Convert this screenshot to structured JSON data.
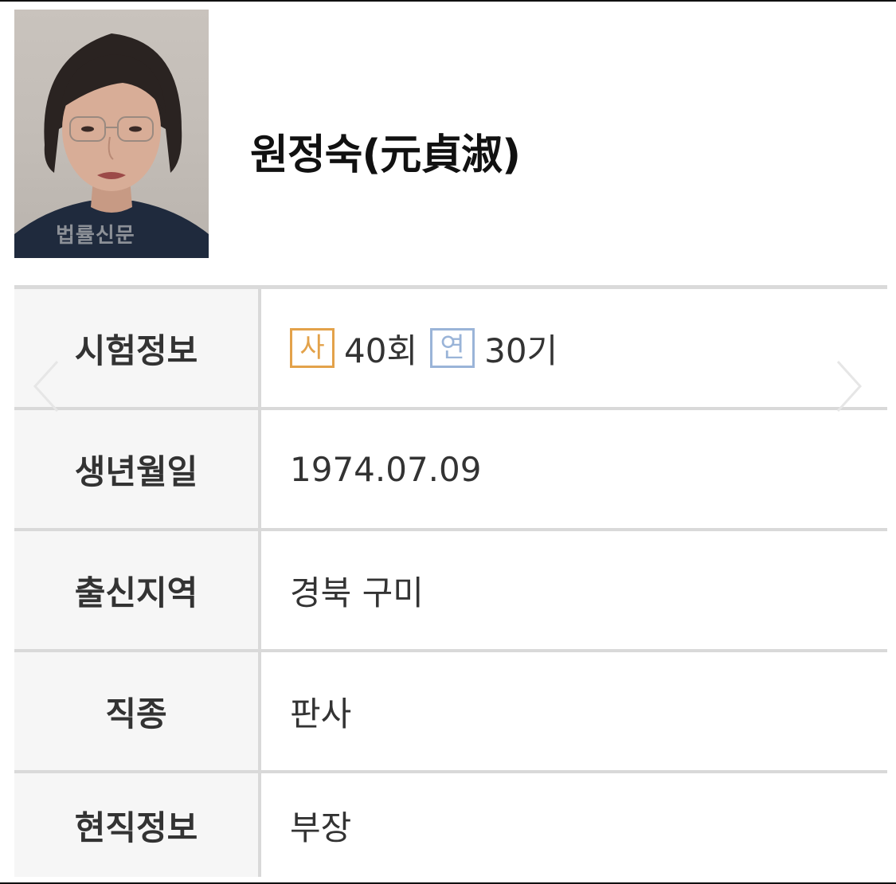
{
  "profile": {
    "name": "원정숙(元貞淑)",
    "photo_watermark": "법률신문"
  },
  "rows": [
    {
      "label": "시험정보",
      "exam_badge": "사",
      "exam_value": "40회",
      "train_badge": "연",
      "train_value": "30기"
    },
    {
      "label": "생년월일",
      "value": "1974.07.09"
    },
    {
      "label": "출신지역",
      "value": "경북 구미"
    },
    {
      "label": "직종",
      "value": "판사"
    },
    {
      "label": "현직정보",
      "value": "부장"
    }
  ],
  "icons": {
    "prev": "chevron-left-icon",
    "next": "chevron-right-icon"
  },
  "colors": {
    "exam_badge": "#e3a24a",
    "train_badge": "#9ab4d8",
    "label_bg": "#f6f6f6",
    "border": "#d9d9d9"
  }
}
